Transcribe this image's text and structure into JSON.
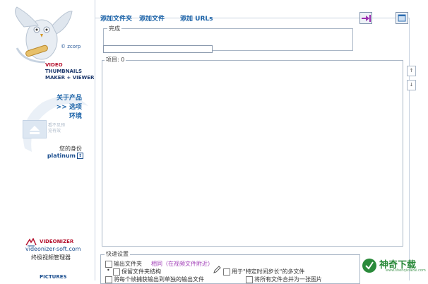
{
  "sidebar": {
    "brand": "© zcorp",
    "product": {
      "line1": "VIDEO",
      "line2": "THUMBNAILS",
      "line3": "MAKER + VIEWER"
    },
    "nav": [
      {
        "label": "关于产品"
      },
      {
        "label": ">> 选项"
      },
      {
        "label": "环境"
      }
    ],
    "preview_text1": "看不见预",
    "preview_text2": "览有效",
    "identity_label": "您的身份",
    "identity_value": "platinum",
    "identity_icon": "↕",
    "vz_name": "VIDEONIZER",
    "vz_url": "videonizer-soft.com",
    "vz_desc": "终极视频管理器",
    "pictures": "PICTURES"
  },
  "toolbar": {
    "add_folder": "添加文件夹",
    "add_file": "添加文件",
    "add_urls": "添加 URLs"
  },
  "main": {
    "done_label": "完成",
    "items_label": "项目: 0",
    "arrow_up": "↑",
    "arrow_down": "↓"
  },
  "quick": {
    "label": "快速设置",
    "output_folder": "输出文件夹",
    "same_folder": "相同（在视频文件附近）",
    "keep_structure": "保留文件夹结构",
    "for_specific": "用于\"特定时间步长\"的多文件",
    "each_frame": "将每个帧捕获输出到单独的输出文件",
    "merge_all": "将所有文件合并为一张图片"
  },
  "watermark": {
    "title": "神奇下载",
    "sub": "www.shenqixiazai.com"
  },
  "colors": {
    "link": "#1c63a8",
    "accent_red": "#b5122e",
    "purple": "#a23fb8",
    "border": "#a9b6c6"
  }
}
